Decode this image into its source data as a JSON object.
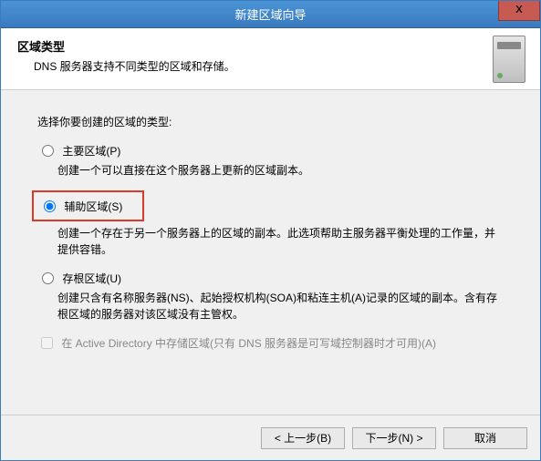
{
  "titlebar": {
    "title": "新建区域向导",
    "close": "x"
  },
  "header": {
    "title": "区域类型",
    "subtitle": "DNS 服务器支持不同类型的区域和存储。"
  },
  "content": {
    "prompt": "选择你要创建的区域的类型:",
    "options": [
      {
        "label": "主要区域(P)",
        "selected": false,
        "description": "创建一个可以直接在这个服务器上更新的区域副本。"
      },
      {
        "label": "辅助区域(S)",
        "selected": true,
        "highlighted": true,
        "description": "创建一个存在于另一个服务器上的区域的副本。此选项帮助主服务器平衡处理的工作量，并提供容错。"
      },
      {
        "label": "存根区域(U)",
        "selected": false,
        "description": "创建只含有名称服务器(NS)、起始授权机构(SOA)和粘连主机(A)记录的区域的副本。含有存根区域的服务器对该区域没有主管权。"
      }
    ],
    "checkbox": {
      "label": "在 Active Directory 中存储区域(只有 DNS 服务器是可写域控制器时才可用)(A)",
      "checked": false,
      "enabled": false
    }
  },
  "footer": {
    "back": "< 上一步(B)",
    "next": "下一步(N) >",
    "cancel": "取消"
  }
}
